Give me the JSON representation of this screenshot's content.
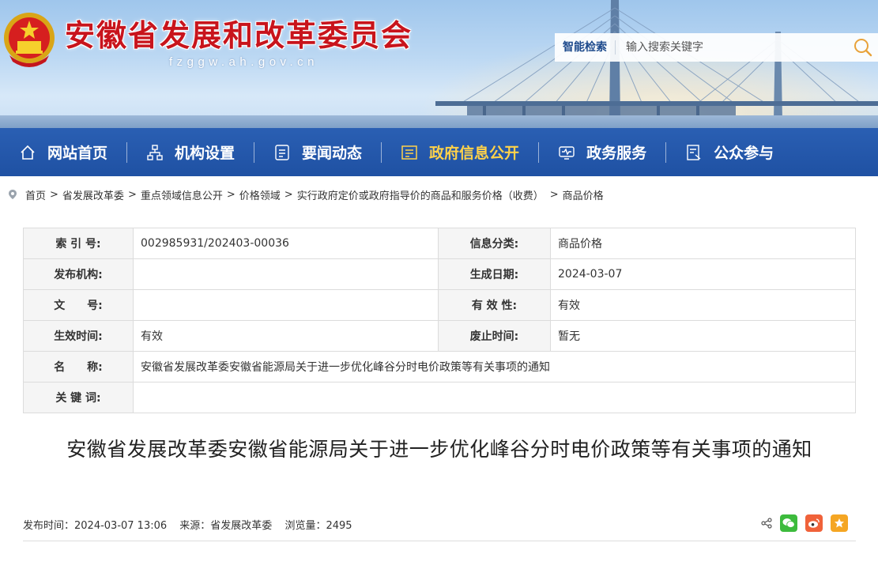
{
  "header": {
    "site_title": "安徽省发展和改革委员会",
    "site_domain": "fzggw.ah.gov.cn",
    "search_label": "智能检索",
    "search_placeholder": "输入搜索关键字"
  },
  "nav": {
    "items": [
      {
        "label": "网站首页",
        "icon": "home-icon"
      },
      {
        "label": "机构设置",
        "icon": "org-chart-icon"
      },
      {
        "label": "要闻动态",
        "icon": "news-icon"
      },
      {
        "label": "政府信息公开",
        "icon": "info-disclosure-icon",
        "active": true
      },
      {
        "label": "政务服务",
        "icon": "service-monitor-icon"
      },
      {
        "label": "公众参与",
        "icon": "participation-icon"
      }
    ],
    "active_color": "#ffd24a",
    "bar_color": "#2458ab"
  },
  "breadcrumb": {
    "items": [
      "首页",
      "省发展改革委",
      "重点领域信息公开",
      "价格领域",
      "实行政府定价或政府指导价的商品和服务价格（收费）",
      "商品价格"
    ],
    "separator": ">"
  },
  "info": {
    "index_label": "索 引 号:",
    "index_value": "002985931/202403-00036",
    "category_label": "信息分类:",
    "category_value": "商品价格",
    "publisher_label": "发布机构:",
    "publisher_value": "",
    "created_label": "生成日期:",
    "created_value": "2024-03-07",
    "docno_label": "文　　号:",
    "docno_value": "",
    "validity_label": "有 效 性:",
    "validity_value": "有效",
    "effective_label": "生效时间:",
    "effective_value": "有效",
    "repeal_label": "废止时间:",
    "repeal_value": "暂无",
    "name_label": "名　　称:",
    "name_value": "安徽省发展改革委安徽省能源局关于进一步优化峰谷分时电价政策等有关事项的通知",
    "keywords_label": "关 键 词:",
    "keywords_value": ""
  },
  "article": {
    "title": "安徽省发展改革委安徽省能源局关于进一步优化峰谷分时电价政策等有关事项的通知",
    "publish_time": "发布时间：2024-03-07 13:06",
    "source": "来源：省发展改革委",
    "views": "浏览量：2495"
  },
  "colors": {
    "title_red": "#c8141c",
    "wechat": "#3dbb3d",
    "weibo": "#f0623a",
    "favorite": "#f5a623"
  }
}
